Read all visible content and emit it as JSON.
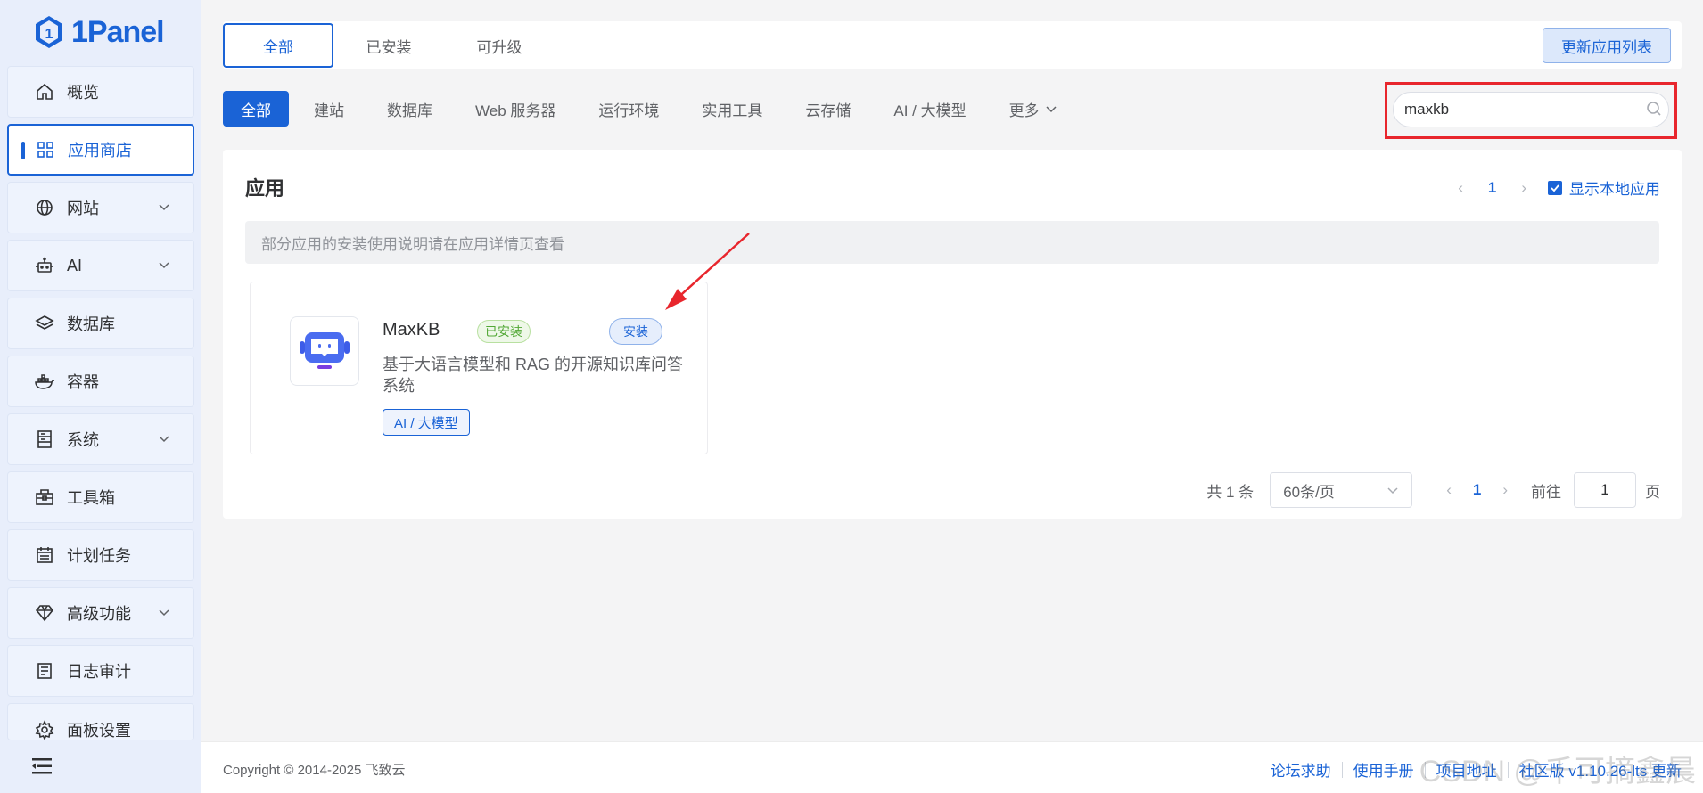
{
  "app": {
    "name": "1Panel"
  },
  "sidebar": {
    "items": [
      {
        "label": "概览",
        "icon": "home-icon",
        "has_children": false
      },
      {
        "label": "应用商店",
        "icon": "grid-icon",
        "has_children": false,
        "active": true
      },
      {
        "label": "网站",
        "icon": "globe-icon",
        "has_children": true
      },
      {
        "label": "AI",
        "icon": "robot-icon",
        "has_children": true
      },
      {
        "label": "数据库",
        "icon": "layers-icon",
        "has_children": false
      },
      {
        "label": "容器",
        "icon": "docker-icon",
        "has_children": false
      },
      {
        "label": "系统",
        "icon": "server-icon",
        "has_children": true
      },
      {
        "label": "工具箱",
        "icon": "toolbox-icon",
        "has_children": false
      },
      {
        "label": "计划任务",
        "icon": "calendar-icon",
        "has_children": false
      },
      {
        "label": "高级功能",
        "icon": "diamond-icon",
        "has_children": true
      },
      {
        "label": "日志审计",
        "icon": "log-icon",
        "has_children": false
      },
      {
        "label": "面板设置",
        "icon": "gear-icon",
        "has_children": false
      }
    ]
  },
  "top_tabs": {
    "all": "全部",
    "installed": "已安装",
    "upgradable": "可升级"
  },
  "refresh_label": "更新应用列表",
  "categories": [
    "全部",
    "建站",
    "数据库",
    "Web 服务器",
    "运行环境",
    "实用工具",
    "云存储",
    "AI / 大模型"
  ],
  "more_label": "更多",
  "search": {
    "value": "maxkb"
  },
  "panel": {
    "title": "应用",
    "page": "1",
    "show_local_label": "显示本地应用",
    "notice": "部分应用的安装使用说明请在应用详情页查看"
  },
  "card": {
    "name": "MaxKB",
    "installed_badge": "已安装",
    "install_label": "安装",
    "description": "基于大语言模型和 RAG 的开源知识库问答系统",
    "tag": "AI / 大模型"
  },
  "pager": {
    "total": "共 1 条",
    "page_size": "60条/页",
    "current": "1",
    "goto_label": "前往",
    "goto_value": "1",
    "page_suffix": "页"
  },
  "footer": {
    "copyright": "Copyright © 2014-2025 飞致云",
    "links": [
      "论坛求助",
      "使用手册",
      "项目地址",
      "社区版 v1.10.26-lts 更新"
    ]
  },
  "watermark": "CSDN @千可摘鑫晨",
  "colors": {
    "accent": "#1a63d6",
    "highlight_red": "#e8262d",
    "success": "#52a836"
  }
}
